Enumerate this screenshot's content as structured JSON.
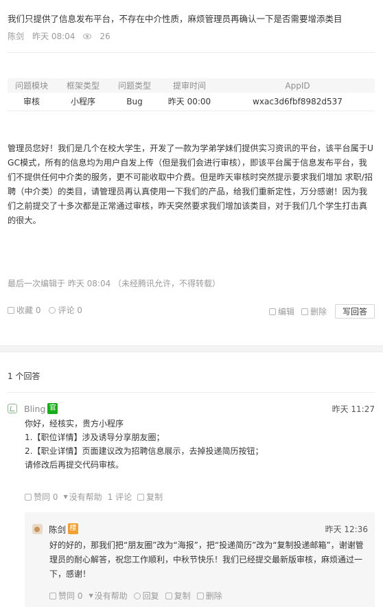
{
  "question": {
    "title": "我们只提供了信息发布平台，不存在中介性质，麻烦管理员再确认一下是否需要增添类目",
    "author": "陈剑",
    "time": "昨天 08:04",
    "views": "26"
  },
  "info_table": {
    "headers": [
      "问题模块",
      "框架类型",
      "问题类型",
      "提审时间",
      "AppID"
    ],
    "row": [
      "审核",
      "小程序",
      "Bug",
      "昨天 00:00",
      "wxac3d6fbf8982d537"
    ]
  },
  "body": "管理员您好！我们是几个在校大学生，开发了一款为学弟学妹们提供实习资讯的平台，该平台属于UGC模式，所有的信息均为用户自发上传（但是我们会进行审核），即该平台属于信息发布平台，我们不提供任何中介类的服务，更不可能收取中介费。但是昨天审核时突然提示要求我们增加 求职/招聘（中介类）的类目，请管理员再认真使用一下我们的产品，给我们重新定性，万分感谢！因为我们之前提交了十多次都是正常通过审核，昨天突然要求我们增加该类目，对于我们几个学生打击真的很大。",
  "edited": "最后一次编辑于  昨天 08:04  （未经腾讯允许，不得转载）",
  "actions": {
    "favorite": "收藏 0",
    "comment": "评论 0",
    "edit": "编辑",
    "delete": "删除",
    "write_answer": "写回答"
  },
  "answers_count": "1 个回答",
  "answer": {
    "author": "Bling",
    "badge": "官",
    "time": "昨天 11:27",
    "lines": [
      "你好，经核实，贵方小程序",
      "1.【职位详情】涉及诱导分享朋友圈；",
      "2.【职业详情】页面建议改为招聘信息展示，去掉投递简历按钮；",
      "请修改后再提交代码审核。"
    ],
    "like": "赞同 0",
    "unhelpful": "没有帮助",
    "comment": "1 评论",
    "copy": "复制"
  },
  "reply": {
    "author": "陈剑",
    "badge": "楼",
    "time": "昨天 12:36",
    "text": "好的好的，那我们把“朋友圈”改为“海报”，把“投递简历”改为“复制投递邮箱”，谢谢管理员的耐心解答，祝您工作顺利，中秋节快乐！我们已经提交最新版审核，麻烦通过一下，感谢！",
    "like": "赞同 0",
    "unhelpful": "没有帮助",
    "reply": "回复",
    "copy": "复制",
    "delete": "删除"
  }
}
